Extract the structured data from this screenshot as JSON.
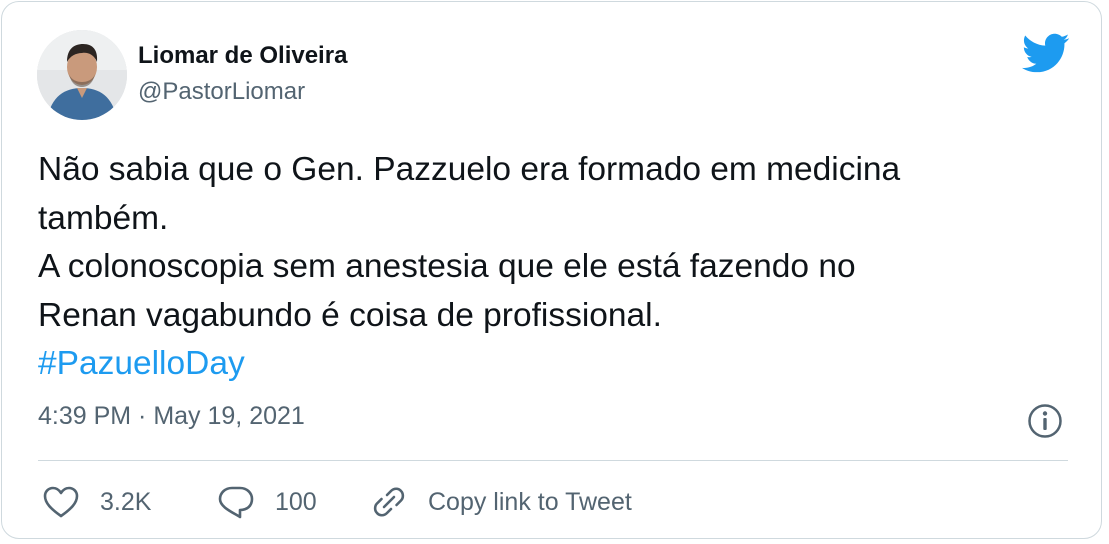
{
  "author": {
    "name": "Liomar de Oliveira",
    "handle": "@PastorLiomar"
  },
  "tweet": {
    "lines": [
      "Não sabia que o Gen. Pazzuelo era formado em medicina",
      "também.",
      "A colonoscopia sem anestesia que ele está fazendo no",
      "Renan vagabundo é coisa de profissional."
    ],
    "hashtag": "#PazuelloDay"
  },
  "meta": {
    "timestamp": "4:39 PM · May 19, 2021"
  },
  "actions": {
    "likes": "3.2K",
    "replies": "100",
    "copy_link": "Copy link to Tweet"
  },
  "colors": {
    "brand_blue": "#1d9bf0",
    "secondary_text": "#536471",
    "border": "#cfd9de"
  },
  "icons": {
    "logo": "twitter-bird-icon",
    "info": "info-icon",
    "like": "heart-icon",
    "reply": "reply-bubble-icon",
    "copy": "link-icon"
  }
}
